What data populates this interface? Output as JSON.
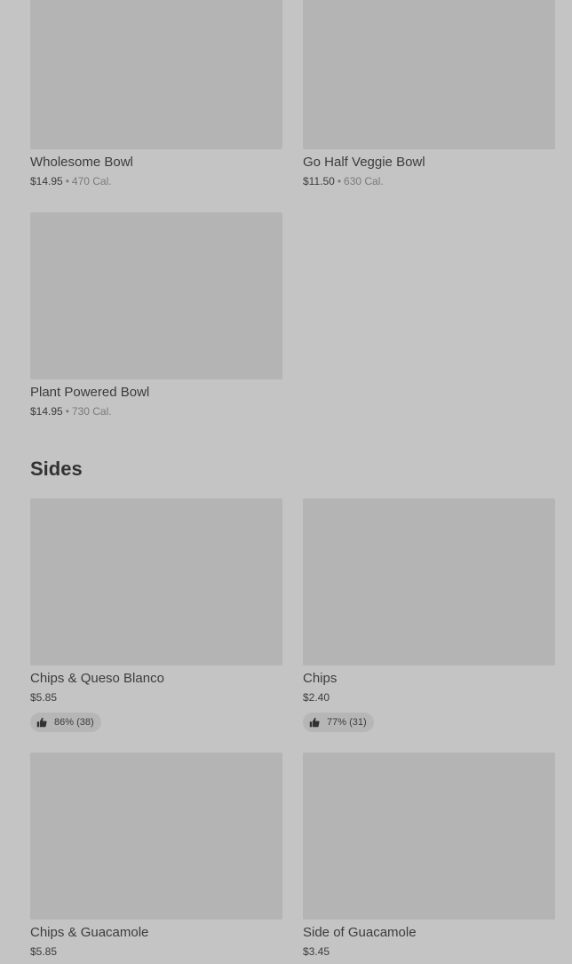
{
  "bowls": [
    {
      "name": "Wholesome Bowl",
      "price": "$14.95",
      "separator": "•",
      "calories": "470 Cal."
    },
    {
      "name": "Go Half Veggie Bowl",
      "price": "$11.50",
      "separator": "•",
      "calories": "630 Cal."
    },
    {
      "name": "Plant Powered Bowl",
      "price": "$14.95",
      "separator": "•",
      "calories": "730 Cal."
    }
  ],
  "sides_section": {
    "title": "Sides"
  },
  "sides": [
    {
      "name": "Chips & Queso Blanco",
      "price": "$5.85",
      "rating": "86% (38)"
    },
    {
      "name": "Chips",
      "price": "$2.40",
      "rating": "77% (31)"
    },
    {
      "name": "Chips & Guacamole",
      "price": "$5.85"
    },
    {
      "name": "Side of Guacamole",
      "price": "$3.45"
    }
  ],
  "icons": {
    "rating": "thumbs-up-icon"
  }
}
